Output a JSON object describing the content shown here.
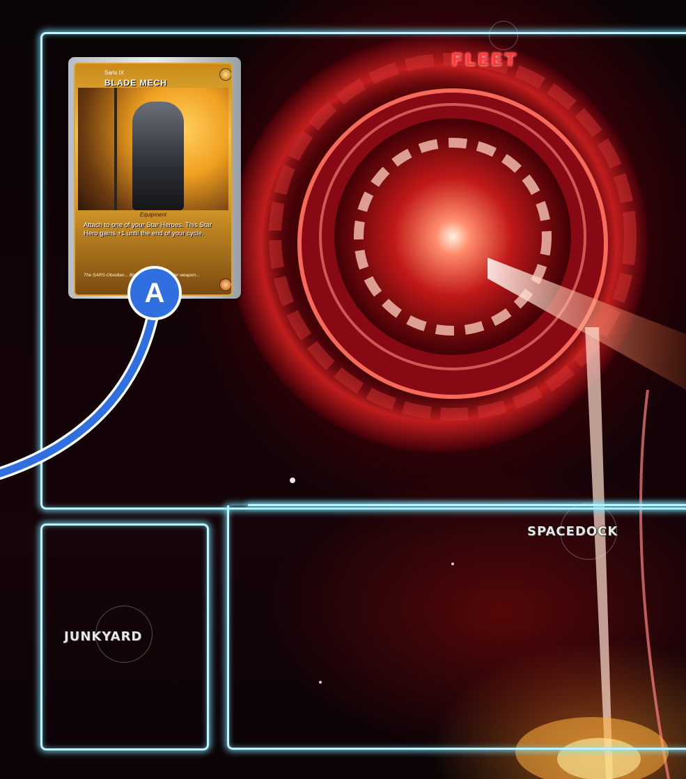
{
  "board": {
    "zones": {
      "fleet": "FLEET",
      "spacedock": "SPACEDOCK",
      "junkyard": "JUNKYARD"
    }
  },
  "card": {
    "faction": "Saris IX",
    "name": "BLADE MECH",
    "type": "Equipment",
    "text": "Attach to one of your Star Heroes. This Star Hero gains +1 until the end of your cycle.",
    "flavor": "The SARS-Obsidian... Blade Mech, the premier weapon..."
  },
  "callout": {
    "label": "A",
    "color": "#2f6fe0"
  },
  "colors": {
    "zone_border": "#bff4ff",
    "fleet_title": "#ff3a3a"
  }
}
